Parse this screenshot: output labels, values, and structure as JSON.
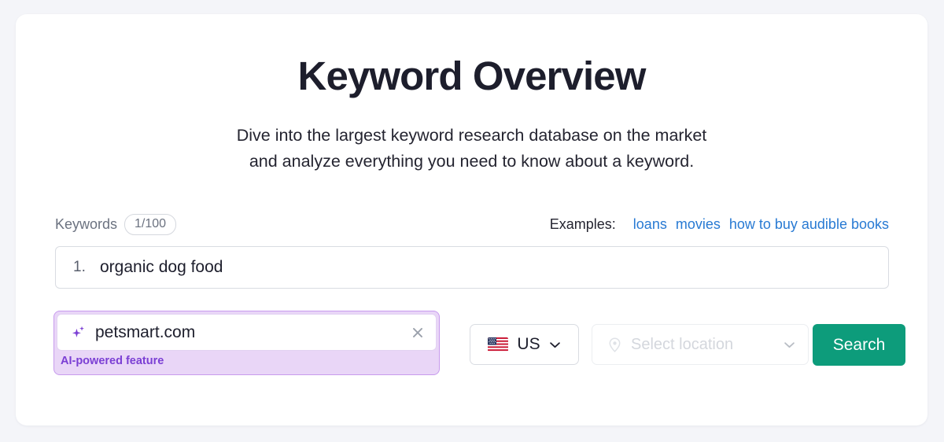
{
  "page": {
    "title": "Keyword Overview",
    "subtitle_line1": "Dive into the largest keyword research database on the market",
    "subtitle_line2": "and analyze everything you need to know about a keyword."
  },
  "keywords_section": {
    "label": "Keywords",
    "counter": "1/100",
    "index": "1.",
    "value": "organic dog food"
  },
  "examples": {
    "label": "Examples:",
    "items": [
      {
        "text": "loans"
      },
      {
        "text": "movies"
      },
      {
        "text": "how to buy audible books"
      }
    ]
  },
  "ai_field": {
    "icon": "sparkle-icon",
    "value": "petsmart.com",
    "clear_icon": "close-icon",
    "note": "AI-powered feature"
  },
  "country_select": {
    "flag": "us-flag-icon",
    "code": "US",
    "chevron": "chevron-down-icon"
  },
  "location_select": {
    "icon": "location-pin-icon",
    "placeholder": "Select location",
    "chevron": "chevron-down-icon"
  },
  "search_button": {
    "label": "Search"
  },
  "colors": {
    "page_background": "#f4f5f9",
    "card_background": "#ffffff",
    "title": "#1d1e2c",
    "link_blue": "#287ad3",
    "ai_purple": "#7b3fd4",
    "ai_background": "#e9d6f7",
    "ai_border": "#c79bed",
    "search_green": "#0d9c7b",
    "muted_text": "#6b7280",
    "placeholder": "#d4d7dd"
  }
}
